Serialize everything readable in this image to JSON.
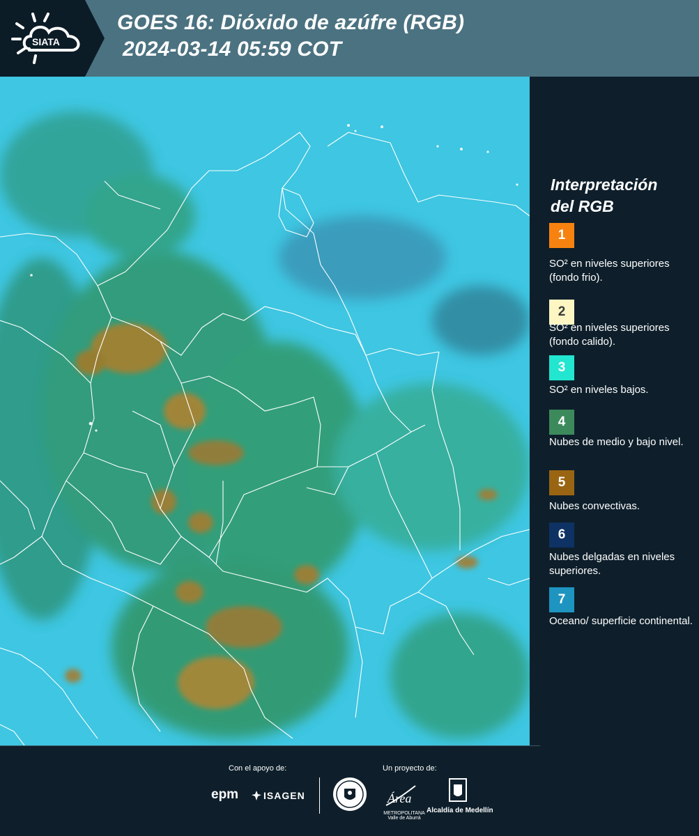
{
  "header": {
    "logo_text": "SIATA",
    "title_line1": "GOES 16: Dióxido de azúfre (RGB)",
    "title_line2": "2024-03-14 05:59 COT"
  },
  "legend": {
    "title_line1": "Interpretación",
    "title_line2": "del RGB",
    "items": [
      {
        "num": "1",
        "color": "#f7820f",
        "label": "SO² en niveles superiores (fondo frio)."
      },
      {
        "num": "2",
        "color": "#fdf6c3",
        "label": "SO² en niveles superiores (fondo calido)."
      },
      {
        "num": "3",
        "color": "#22e6cf",
        "label": "SO² en niveles bajos."
      },
      {
        "num": "4",
        "color": "#3c8a5c",
        "label": "Nubes de medio y bajo nivel."
      },
      {
        "num": "5",
        "color": "#9a6512",
        "label": "Nubes convectivas."
      },
      {
        "num": "6",
        "color": "#0d3263",
        "label": "Nubes delgadas en niveles superiores."
      },
      {
        "num": "7",
        "color": "#1d95c0",
        "label": "Oceano/ superficie continental."
      }
    ]
  },
  "footer": {
    "support_label": "Con el apoyo de:",
    "project_label": "Un proyecto de:",
    "epm": "epm",
    "isagen": "ISAGEN",
    "area_text": "METROPOLITANA Valle de Aburrá",
    "alcaldia": "Alcaldía de Medellín"
  },
  "colors": {
    "header_band": "#4b7280",
    "panel": "#0e1f2b",
    "ocean": "#3cc8e4",
    "land_green": "#2f9a62",
    "convective": "#a8812f"
  }
}
